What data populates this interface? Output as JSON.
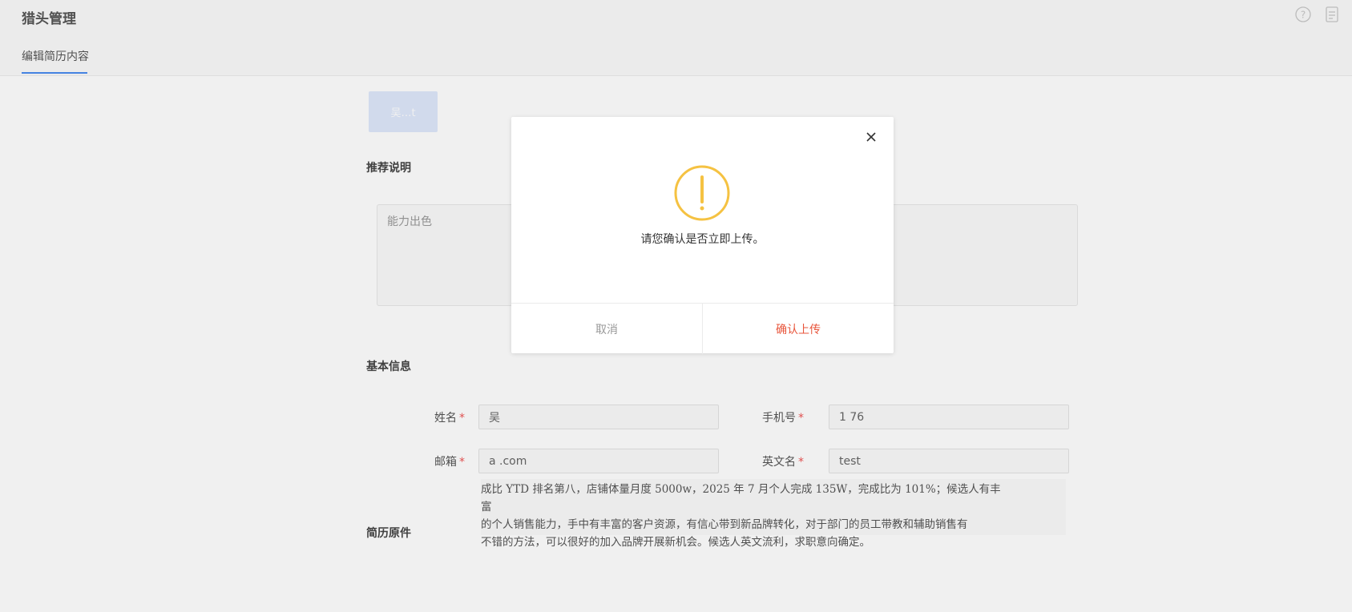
{
  "header": {
    "title": "猎头管理",
    "tab": "编辑简历内容"
  },
  "candidate_pill": "吴…t",
  "recommend": {
    "title": "推荐说明",
    "text": "能力出色"
  },
  "basic_info": {
    "title": "基本信息",
    "name_label": "姓名",
    "name_value": "吴 ",
    "phone_label": "手机号",
    "phone_value": "1 76",
    "email_label": "邮箱",
    "email_value": "a .com",
    "english_name_label": "英文名",
    "english_name_value": "test",
    "required_mark": "*"
  },
  "resume": {
    "title": "简历原件",
    "lines": [
      "成比 YTD 排名第八，店铺体量月度 5000w，2025 年 7 月个人完成 135W，完成比为 101%；候选人有丰富",
      "的个人销售能力，手中有丰富的客户资源，有信心带到新品牌转化，对于部门的员工带教和辅助销售有",
      "不错的方法，可以很好的加入品牌开展新机会。候选人英文流利，求职意向确定。"
    ]
  },
  "dialog": {
    "message": "请您确认是否立即上传。",
    "cancel_label": "取消",
    "confirm_label": "确认上传"
  },
  "colors": {
    "warning": "#f5c242",
    "confirm": "#e8553b",
    "accent": "#4a8cf0"
  },
  "icons": [
    "help-icon",
    "document-icon",
    "close-icon",
    "warning-icon"
  ]
}
